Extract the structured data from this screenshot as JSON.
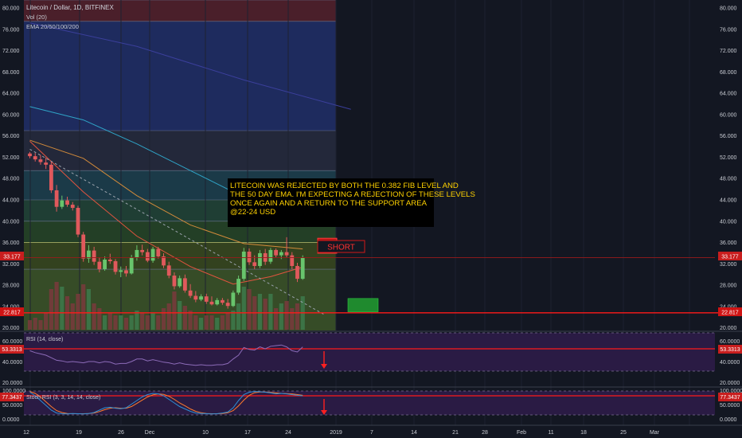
{
  "header": {
    "symbol": "Litecoin / Dollar, 1D, BITFINEX",
    "volume_label": "Vol (20)",
    "ema_label": "EMA 20/50/100/200"
  },
  "annotation": {
    "text_lines": [
      "LITECOIN WAS REJECTED BY BOTH THE 0.382 FIB LEVEL AND",
      "THE 50 DAY EMA. I'M EXPECTING A REJECTION OF THESE LEVELS",
      "ONCE AGAIN  AND A RETURN TO THE SUPPORT AREA",
      "@22-24 USD"
    ],
    "short_label": "SHORT"
  },
  "price_badges": {
    "current": "33.177",
    "support": "22.817"
  },
  "rsi_panel": {
    "label": "RSI (14, close)",
    "badge": "53.3313",
    "ticks": [
      "60.0000",
      "40.0000",
      "20.0000"
    ]
  },
  "stoch_panel": {
    "label": "Stoch RSI (3, 3, 14, 14, close)",
    "badge": "77.3437",
    "ticks": [
      "100.0000",
      "50.0000",
      "0.0000"
    ]
  },
  "colors": {
    "background": "#131722",
    "up": "#68c46c",
    "down": "#e0595c",
    "resistance": "#ff1a1a",
    "annotation_bg": "#000000",
    "annotation_text": "#ffd200",
    "target_box": "#1f8a2e",
    "rsi_line": "#8c6bb8"
  },
  "chart_data": {
    "type": "candlestick",
    "title": "Litecoin / Dollar, 1D, BITFINEX",
    "x_ticks": [
      "12",
      "19",
      "26",
      "Dec",
      "10",
      "17",
      "24",
      "2019",
      "7",
      "14",
      "21",
      "28",
      "Feb",
      "11",
      "18",
      "25",
      "Mar"
    ],
    "y_ticks": [
      "80.000",
      "76.000",
      "72.000",
      "68.000",
      "64.000",
      "60.000",
      "56.000",
      "52.000",
      "48.000",
      "44.000",
      "40.000",
      "36.000",
      "32.000",
      "28.000",
      "24.000",
      "20.000"
    ],
    "ylim": [
      19.5,
      81.5
    ],
    "grid": true,
    "candles": [
      [
        52.7,
        53.0,
        51.8,
        52.2
      ],
      [
        52.2,
        52.8,
        51.2,
        51.6
      ],
      [
        51.6,
        52.4,
        50.6,
        51.1
      ],
      [
        51.0,
        52.0,
        49.8,
        50.6
      ],
      [
        50.6,
        51.2,
        45.3,
        45.8
      ],
      [
        45.8,
        46.8,
        41.8,
        42.7
      ],
      [
        42.7,
        44.8,
        42.3,
        43.9
      ],
      [
        43.9,
        44.6,
        42.7,
        43.1
      ],
      [
        43.1,
        43.6,
        42.0,
        42.5
      ],
      [
        42.5,
        42.9,
        37.0,
        37.5
      ],
      [
        37.5,
        38.0,
        32.4,
        33.0
      ],
      [
        33.0,
        35.5,
        32.2,
        34.5
      ],
      [
        34.5,
        35.2,
        31.8,
        32.4
      ],
      [
        32.4,
        33.2,
        30.4,
        31.0
      ],
      [
        31.0,
        33.4,
        30.7,
        32.8
      ],
      [
        32.8,
        33.9,
        32.0,
        32.5
      ],
      [
        32.5,
        32.9,
        30.0,
        30.5
      ],
      [
        30.5,
        31.5,
        29.5,
        30.8
      ],
      [
        30.8,
        31.6,
        29.6,
        30.2
      ],
      [
        30.2,
        33.7,
        30.0,
        33.2
      ],
      [
        33.2,
        35.5,
        32.6,
        34.6
      ],
      [
        34.6,
        35.6,
        33.6,
        34.2
      ],
      [
        34.2,
        34.8,
        32.3,
        32.6
      ],
      [
        32.6,
        35.2,
        32.2,
        34.8
      ],
      [
        34.8,
        35.2,
        33.0,
        33.4
      ],
      [
        33.4,
        34.0,
        31.2,
        31.7
      ],
      [
        31.7,
        32.4,
        29.3,
        29.8
      ],
      [
        29.8,
        30.4,
        27.2,
        27.8
      ],
      [
        27.8,
        29.8,
        27.5,
        29.3
      ],
      [
        29.3,
        30.0,
        26.6,
        27.0
      ],
      [
        27.0,
        28.2,
        25.6,
        26.0
      ],
      [
        26.0,
        26.9,
        24.8,
        25.3
      ],
      [
        25.3,
        26.3,
        25.0,
        25.9
      ],
      [
        25.9,
        26.4,
        24.5,
        24.9
      ],
      [
        24.9,
        25.9,
        24.2,
        24.4
      ],
      [
        24.4,
        25.6,
        24.2,
        25.2
      ],
      [
        25.2,
        25.6,
        24.3,
        24.7
      ],
      [
        24.7,
        25.4,
        23.6,
        24.1
      ],
      [
        24.1,
        27.0,
        23.9,
        26.6
      ],
      [
        26.6,
        29.8,
        26.2,
        29.2
      ],
      [
        29.2,
        35.0,
        28.8,
        34.3
      ],
      [
        34.3,
        34.9,
        31.8,
        32.3
      ],
      [
        32.3,
        33.6,
        31.0,
        31.6
      ],
      [
        31.6,
        34.6,
        31.2,
        34.0
      ],
      [
        34.0,
        34.8,
        31.8,
        32.4
      ],
      [
        32.4,
        35.0,
        32.0,
        34.6
      ],
      [
        34.6,
        34.9,
        33.2,
        33.6
      ],
      [
        33.6,
        34.6,
        32.9,
        34.2
      ],
      [
        34.2,
        37.0,
        33.2,
        33.6
      ],
      [
        33.6,
        34.2,
        31.0,
        31.6
      ],
      [
        31.6,
        32.2,
        28.6,
        29.2
      ],
      [
        29.2,
        33.6,
        29.0,
        33.1
      ]
    ],
    "volume_relative": [
      0.2,
      0.25,
      0.2,
      0.35,
      0.85,
      1.0,
      0.9,
      0.7,
      0.55,
      0.75,
      0.95,
      0.85,
      0.55,
      0.45,
      0.3,
      0.35,
      0.3,
      0.3,
      0.25,
      0.3,
      0.4,
      0.35,
      0.3,
      0.35,
      0.3,
      0.45,
      0.55,
      0.8,
      0.6,
      0.5,
      0.4,
      0.3,
      0.25,
      0.3,
      0.3,
      0.25,
      0.3,
      0.35,
      0.4,
      0.55,
      0.9,
      0.85,
      0.7,
      0.75,
      0.65,
      0.75,
      0.45,
      0.55,
      0.6,
      0.45,
      0.55,
      0.7
    ],
    "ema_series": [
      {
        "period": 20,
        "color": "#e2543f",
        "values": [
          {
            "i": 0,
            "v": 55.0
          },
          {
            "i": 10,
            "v": 45.5
          },
          {
            "i": 20,
            "v": 37.2
          },
          {
            "i": 30,
            "v": 31.5
          },
          {
            "i": 38,
            "v": 28.2
          },
          {
            "i": 45,
            "v": 29.6
          },
          {
            "i": 51,
            "v": 31.4
          }
        ]
      },
      {
        "period": 50,
        "color": "#d18a3a",
        "values": [
          {
            "i": 0,
            "v": 55.2
          },
          {
            "i": 10,
            "v": 51.8
          },
          {
            "i": 20,
            "v": 44.8
          },
          {
            "i": 30,
            "v": 39.3
          },
          {
            "i": 40,
            "v": 35.8
          },
          {
            "i": 51,
            "v": 34.8
          }
        ]
      },
      {
        "period": 100,
        "color": "#2fa3c6",
        "values": [
          {
            "i": 0,
            "v": 61.5
          },
          {
            "i": 10,
            "v": 59.0
          },
          {
            "i": 20,
            "v": 54.5
          },
          {
            "i": 30,
            "v": 49.5
          },
          {
            "i": 38,
            "v": 45.5
          }
        ]
      },
      {
        "period": 200,
        "color": "#3b3f9b",
        "values": [
          {
            "i": 0,
            "v": 77.2
          },
          {
            "i": 20,
            "v": 72.8
          },
          {
            "i": 40,
            "v": 66.5
          },
          {
            "i": 60,
            "v": 61.0
          }
        ]
      }
    ],
    "fib_levels": [
      81.5,
      77.5,
      57.0,
      49.5,
      44.0,
      40.0,
      36.0,
      31.0
    ],
    "lines": {
      "support": 22.817,
      "current": 33.177,
      "trend_from": [
        0,
        53.5
      ],
      "trend_to": [
        55,
        22.5
      ]
    },
    "zones": {
      "short": [
        34.0,
        36.8
      ],
      "target": [
        23.0,
        25.5
      ]
    },
    "rsi": [
      47,
      44,
      42,
      40,
      36,
      32,
      31,
      29,
      30,
      29,
      28,
      30,
      30,
      28,
      30,
      29,
      26,
      27,
      27,
      30,
      34,
      34,
      31,
      33,
      31,
      29,
      28,
      26,
      28,
      26,
      25,
      24,
      25,
      24,
      24,
      25,
      25,
      27,
      34,
      40,
      52,
      49,
      48,
      53,
      50,
      54,
      55,
      56,
      53,
      47,
      45,
      53
    ],
    "rsi_levels": [
      70,
      30
    ],
    "stoch_k": [
      95,
      80,
      60,
      40,
      20,
      8,
      5,
      4,
      6,
      5,
      4,
      6,
      10,
      20,
      30,
      32,
      28,
      26,
      30,
      45,
      60,
      75,
      85,
      90,
      88,
      80,
      65,
      50,
      35,
      25,
      15,
      8,
      6,
      5,
      4,
      5,
      8,
      12,
      30,
      60,
      85,
      95,
      98,
      97,
      95,
      92,
      88,
      90,
      88,
      85,
      82,
      80
    ],
    "stoch_d": [
      98,
      90,
      75,
      55,
      35,
      18,
      10,
      6,
      5,
      5,
      5,
      6,
      8,
      14,
      22,
      28,
      30,
      28,
      28,
      35,
      48,
      62,
      75,
      84,
      88,
      86,
      78,
      65,
      50,
      38,
      25,
      15,
      9,
      6,
      5,
      5,
      6,
      9,
      18,
      38,
      62,
      82,
      93,
      96,
      96,
      94,
      92,
      90,
      89,
      88,
      85,
      82
    ],
    "stoch_levels": [
      80,
      20
    ]
  }
}
